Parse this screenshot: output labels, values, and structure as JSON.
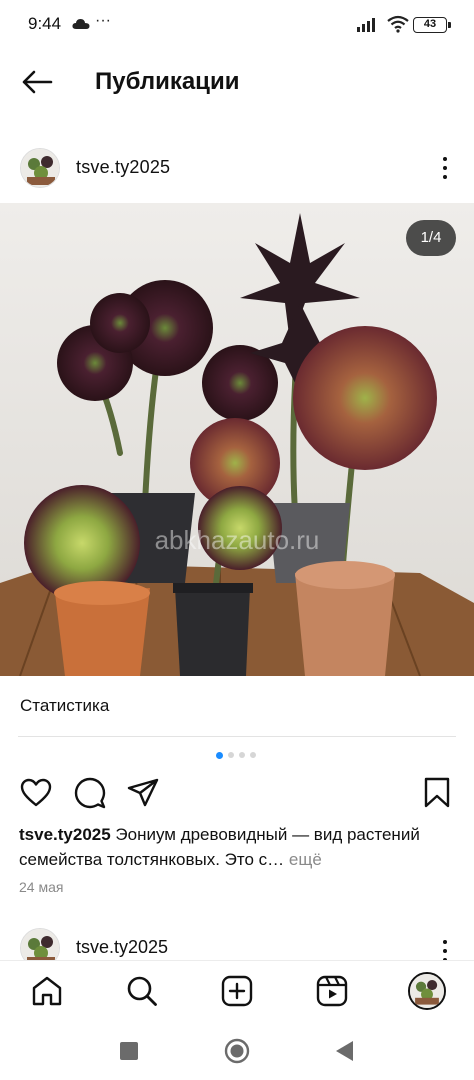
{
  "status_bar": {
    "time": "9:44",
    "extra_icons": "···",
    "battery": "43"
  },
  "header": {
    "title": "Публикации",
    "back_icon": "arrow-left-icon"
  },
  "post": {
    "username": "tsve.ty2025",
    "photo_counter": "1/4",
    "photo_watermark": "abkhazauto.ru",
    "stats_label": "Статистика",
    "carousel": {
      "total": 4,
      "active_index": 0
    },
    "actions": [
      "heart-icon",
      "comment-icon",
      "share-icon",
      "bookmark-icon"
    ],
    "caption_user": "tsve.ty2025",
    "caption_text": " Эониум древовидный — вид растений семейства толстянковых. Это с…",
    "caption_more": " ещё",
    "date": "24 мая"
  },
  "next_post": {
    "username": "tsve.ty2025"
  },
  "bottom_nav": [
    "home-icon",
    "search-icon",
    "create-icon",
    "reels-icon",
    "profile-avatar"
  ],
  "system_nav": [
    "recents-button",
    "home-button",
    "back-button"
  ],
  "colors": {
    "accent": "#1a8cff",
    "text": "#111111",
    "muted": "#8a8a8a"
  }
}
